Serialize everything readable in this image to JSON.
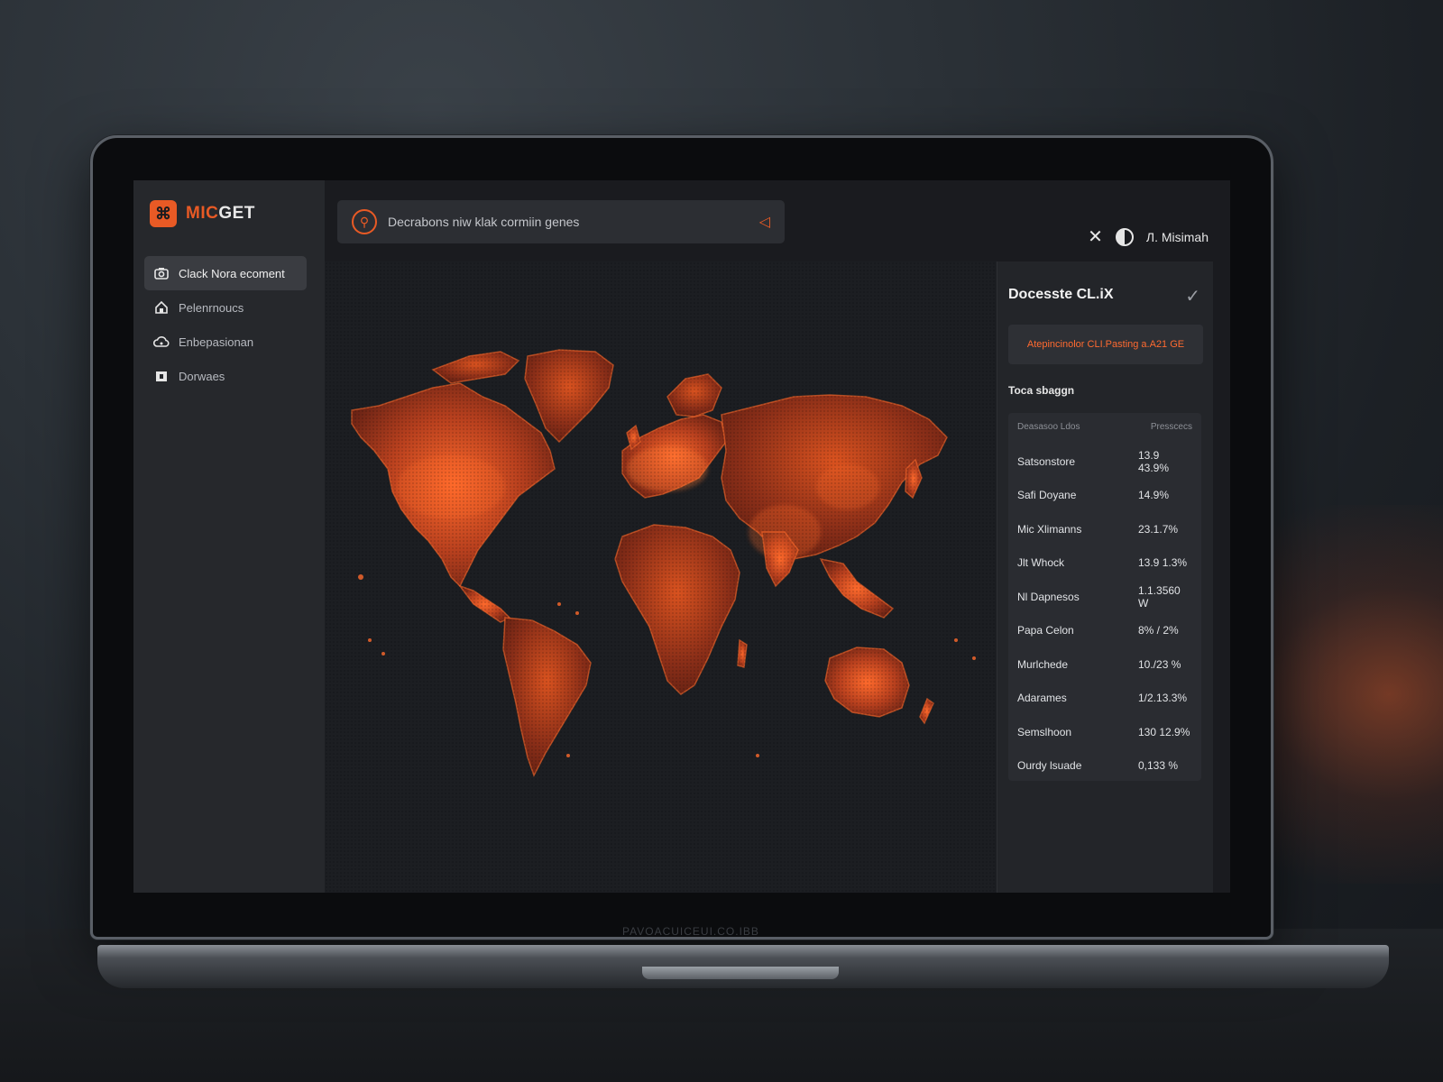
{
  "app": {
    "brand_prefix": "MIC",
    "brand_suffix": "GET",
    "bezel_text": "PAVOACUICEUI.CO.IBB"
  },
  "sidebar": {
    "items": [
      {
        "label": "Clack Nora ecoment",
        "icon": "camera-icon",
        "active": true
      },
      {
        "label": "Pelenrnoucs",
        "icon": "home-icon",
        "active": false
      },
      {
        "label": "Enbepasionan",
        "icon": "cloud-icon",
        "active": false
      },
      {
        "label": "Dorwaes",
        "icon": "box-icon",
        "active": false
      }
    ]
  },
  "search": {
    "text": "Decrabons niw klak cormiin genes"
  },
  "topbar": {
    "user_name": "Л. Misimah"
  },
  "map": {
    "color_low": "#5a1e12",
    "color_high": "#ff6a2c"
  },
  "panel": {
    "title": "Docesste CL.iX",
    "alert": "Atepincinolor CLI.Pasting a.A21 GE",
    "subtitle": "Toca sbaggn",
    "table": {
      "headers": [
        "Deasasoo Ldos",
        "Presscecs"
      ],
      "rows": [
        [
          "Satsonstore",
          "13.9 43.9%"
        ],
        [
          "Safi Doyane",
          "14.9%"
        ],
        [
          "Mic Xlimanns",
          "23.1.7%"
        ],
        [
          "Jlt Whock",
          "13.9 1.3%"
        ],
        [
          "Nl Dapnesos",
          "1.1.3560 W"
        ],
        [
          "Papa Celon",
          "8% / 2%"
        ],
        [
          "Murlchede",
          "10./23 %"
        ],
        [
          "Adarames",
          "1/2.13.3%"
        ],
        [
          "Semslhoon",
          "130 12.9%"
        ],
        [
          "Ourdy lsuade",
          "0,133 %"
        ]
      ]
    }
  },
  "colors": {
    "accent": "#e85a25",
    "bg": "#1a1b1f"
  }
}
